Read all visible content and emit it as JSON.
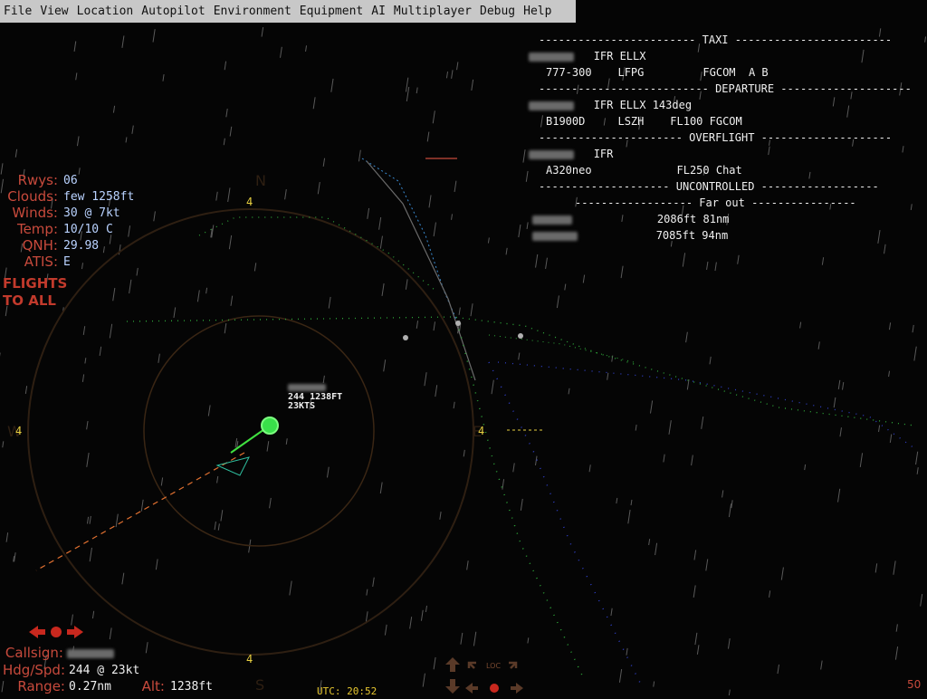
{
  "menu": [
    "File",
    "View",
    "Location",
    "Autopilot",
    "Environment",
    "Equipment",
    "AI",
    "Multiplayer",
    "Debug",
    "Help"
  ],
  "weather": {
    "rows": [
      {
        "label": "Rwys:",
        "value": "06"
      },
      {
        "label": "Clouds:",
        "value": "few 1258ft"
      },
      {
        "label": "Winds:",
        "value": " 30 @ 7kt"
      },
      {
        "label": "Temp:",
        "value": "10/10 C"
      },
      {
        "label": "QNH:",
        "value": "29.98"
      },
      {
        "label": "ATIS:",
        "value": "E"
      }
    ],
    "flights_button": [
      "FLIGHTS",
      "TO ALL"
    ]
  },
  "traffic": {
    "taxi_header": "------------------------ TAXI ------------------------",
    "taxi_row1": "IFR ELLX",
    "taxi_row2": "777-300    LFPG         FGCOM  A B",
    "departure_header": "-------------------------- DEPARTURE --------------------",
    "departure_row1": "IFR ELLX 143deg",
    "departure_row2": "B1900D     LSZH    FL100 FGCOM",
    "overflight_header": "---------------------- OVERFLIGHT --------------------",
    "overflight_row1": "IFR",
    "overflight_row2": "A320neo             FL250 Chat",
    "uncontrolled_header": "-------------------- UNCONTROLLED ------------------",
    "farout_header": "------------------ Far out ----------------",
    "farout_rows": [
      "2086ft 81nm",
      "7085ft 94nm"
    ]
  },
  "radar": {
    "ring_labels": [
      "4",
      "4",
      "4",
      "4"
    ],
    "compass": [
      "N",
      "E",
      "S",
      "W"
    ],
    "target_line1": "244 1238FT",
    "target_line2": "23KTS"
  },
  "ownship": {
    "callsign_label": "Callsign:",
    "hdg_label": "Hdg/Spd:",
    "hdg_value": "244 @  23kt",
    "range_label": "Range:",
    "range_value": "0.27nm",
    "alt_label": "Alt:",
    "alt_value": "1238ft"
  },
  "utc": "UTC: 20:52",
  "fps": "50",
  "nav_label": "LOC",
  "colors": {
    "menubar": "#c8c8c8",
    "label_red": "#c84a3c",
    "value_blue": "#b9d2ff",
    "yellow": "#e8d040"
  }
}
